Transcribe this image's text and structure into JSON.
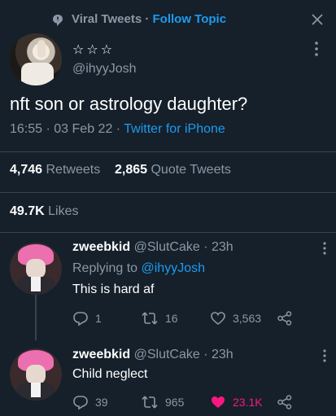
{
  "topic": {
    "source": "Viral Tweets",
    "separator": " · ",
    "follow": "Follow Topic"
  },
  "main_tweet": {
    "display_name": "☆☆☆",
    "handle": "@ihyyJosh",
    "text": "nft son or astrology daughter?",
    "time": "16:55",
    "date": "03 Feb 22",
    "client": "Twitter for iPhone",
    "retweets_count": "4,746",
    "retweets_label": "Retweets",
    "quotes_count": "2,865",
    "quotes_label": "Quote Tweets",
    "likes_count": "49.7K",
    "likes_label": "Likes"
  },
  "replies": [
    {
      "display_name": "zweebkid",
      "handle": "@SlutCake",
      "time": "23h",
      "replying_to_label": "Replying to",
      "replying_to_handle": "@ihyyJosh",
      "text": "This is hard af",
      "reply_count": "1",
      "retweet_count": "16",
      "like_count": "3,563",
      "liked": false
    },
    {
      "display_name": "zweebkid",
      "handle": "@SlutCake",
      "time": "23h",
      "text": "Child neglect",
      "reply_count": "39",
      "retweet_count": "965",
      "like_count": "23.1K",
      "liked": true
    }
  ],
  "colors": {
    "background": "#15202b",
    "accent": "#1d9bf0",
    "muted": "#8b98a5",
    "like": "#f91880"
  }
}
